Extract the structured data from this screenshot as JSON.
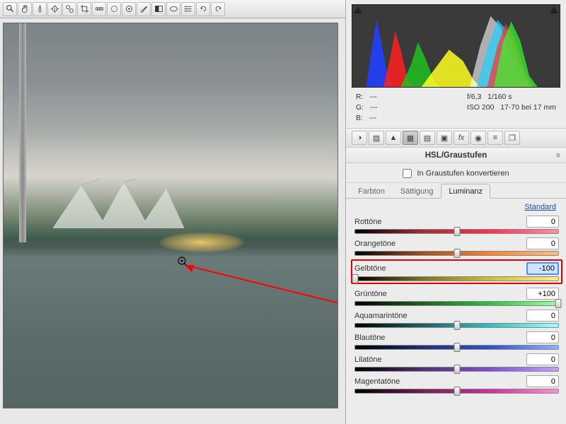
{
  "toolbar_icons": [
    "zoom",
    "hand",
    "wb",
    "color-sampler",
    "target",
    "crop",
    "straighten",
    "spot",
    "redeye",
    "brush",
    "gradient",
    "radial",
    "list",
    "rotate-ccw",
    "rotate-cw"
  ],
  "readout": {
    "r": "R:",
    "r_val": "---",
    "g": "G:",
    "g_val": "---",
    "b": "B:",
    "b_val": "---",
    "aperture": "f/6,3",
    "shutter": "1/160 s",
    "iso": "ISO 200",
    "lens": "17-70 bei 17 mm"
  },
  "panel": {
    "title": "HSL/Graustufen",
    "convert_label": "In Graustufen konvertieren",
    "tabs": [
      "Farbton",
      "Sättigung",
      "Luminanz"
    ],
    "active_tab": 2,
    "standard_link": "Standard"
  },
  "sliders": [
    {
      "label": "Rottöne",
      "value": "0",
      "pos": 50,
      "grad": "g-red",
      "hl": false,
      "focused": false
    },
    {
      "label": "Orangetöne",
      "value": "0",
      "pos": 50,
      "grad": "g-orange",
      "hl": false,
      "focused": false
    },
    {
      "label": "Gelbtöne",
      "value": "-100",
      "pos": 0,
      "grad": "g-yellow",
      "hl": true,
      "focused": true
    },
    {
      "label": "Grüntöne",
      "value": "+100",
      "pos": 100,
      "grad": "g-green",
      "hl": false,
      "focused": false
    },
    {
      "label": "Aquamarintöne",
      "value": "0",
      "pos": 50,
      "grad": "g-aqua",
      "hl": false,
      "focused": false
    },
    {
      "label": "Blautöne",
      "value": "0",
      "pos": 50,
      "grad": "g-blue",
      "hl": false,
      "focused": false
    },
    {
      "label": "Lilatöne",
      "value": "0",
      "pos": 50,
      "grad": "g-purple",
      "hl": false,
      "focused": false
    },
    {
      "label": "Magentatöne",
      "value": "0",
      "pos": 50,
      "grad": "g-magenta",
      "hl": false,
      "focused": false
    }
  ]
}
